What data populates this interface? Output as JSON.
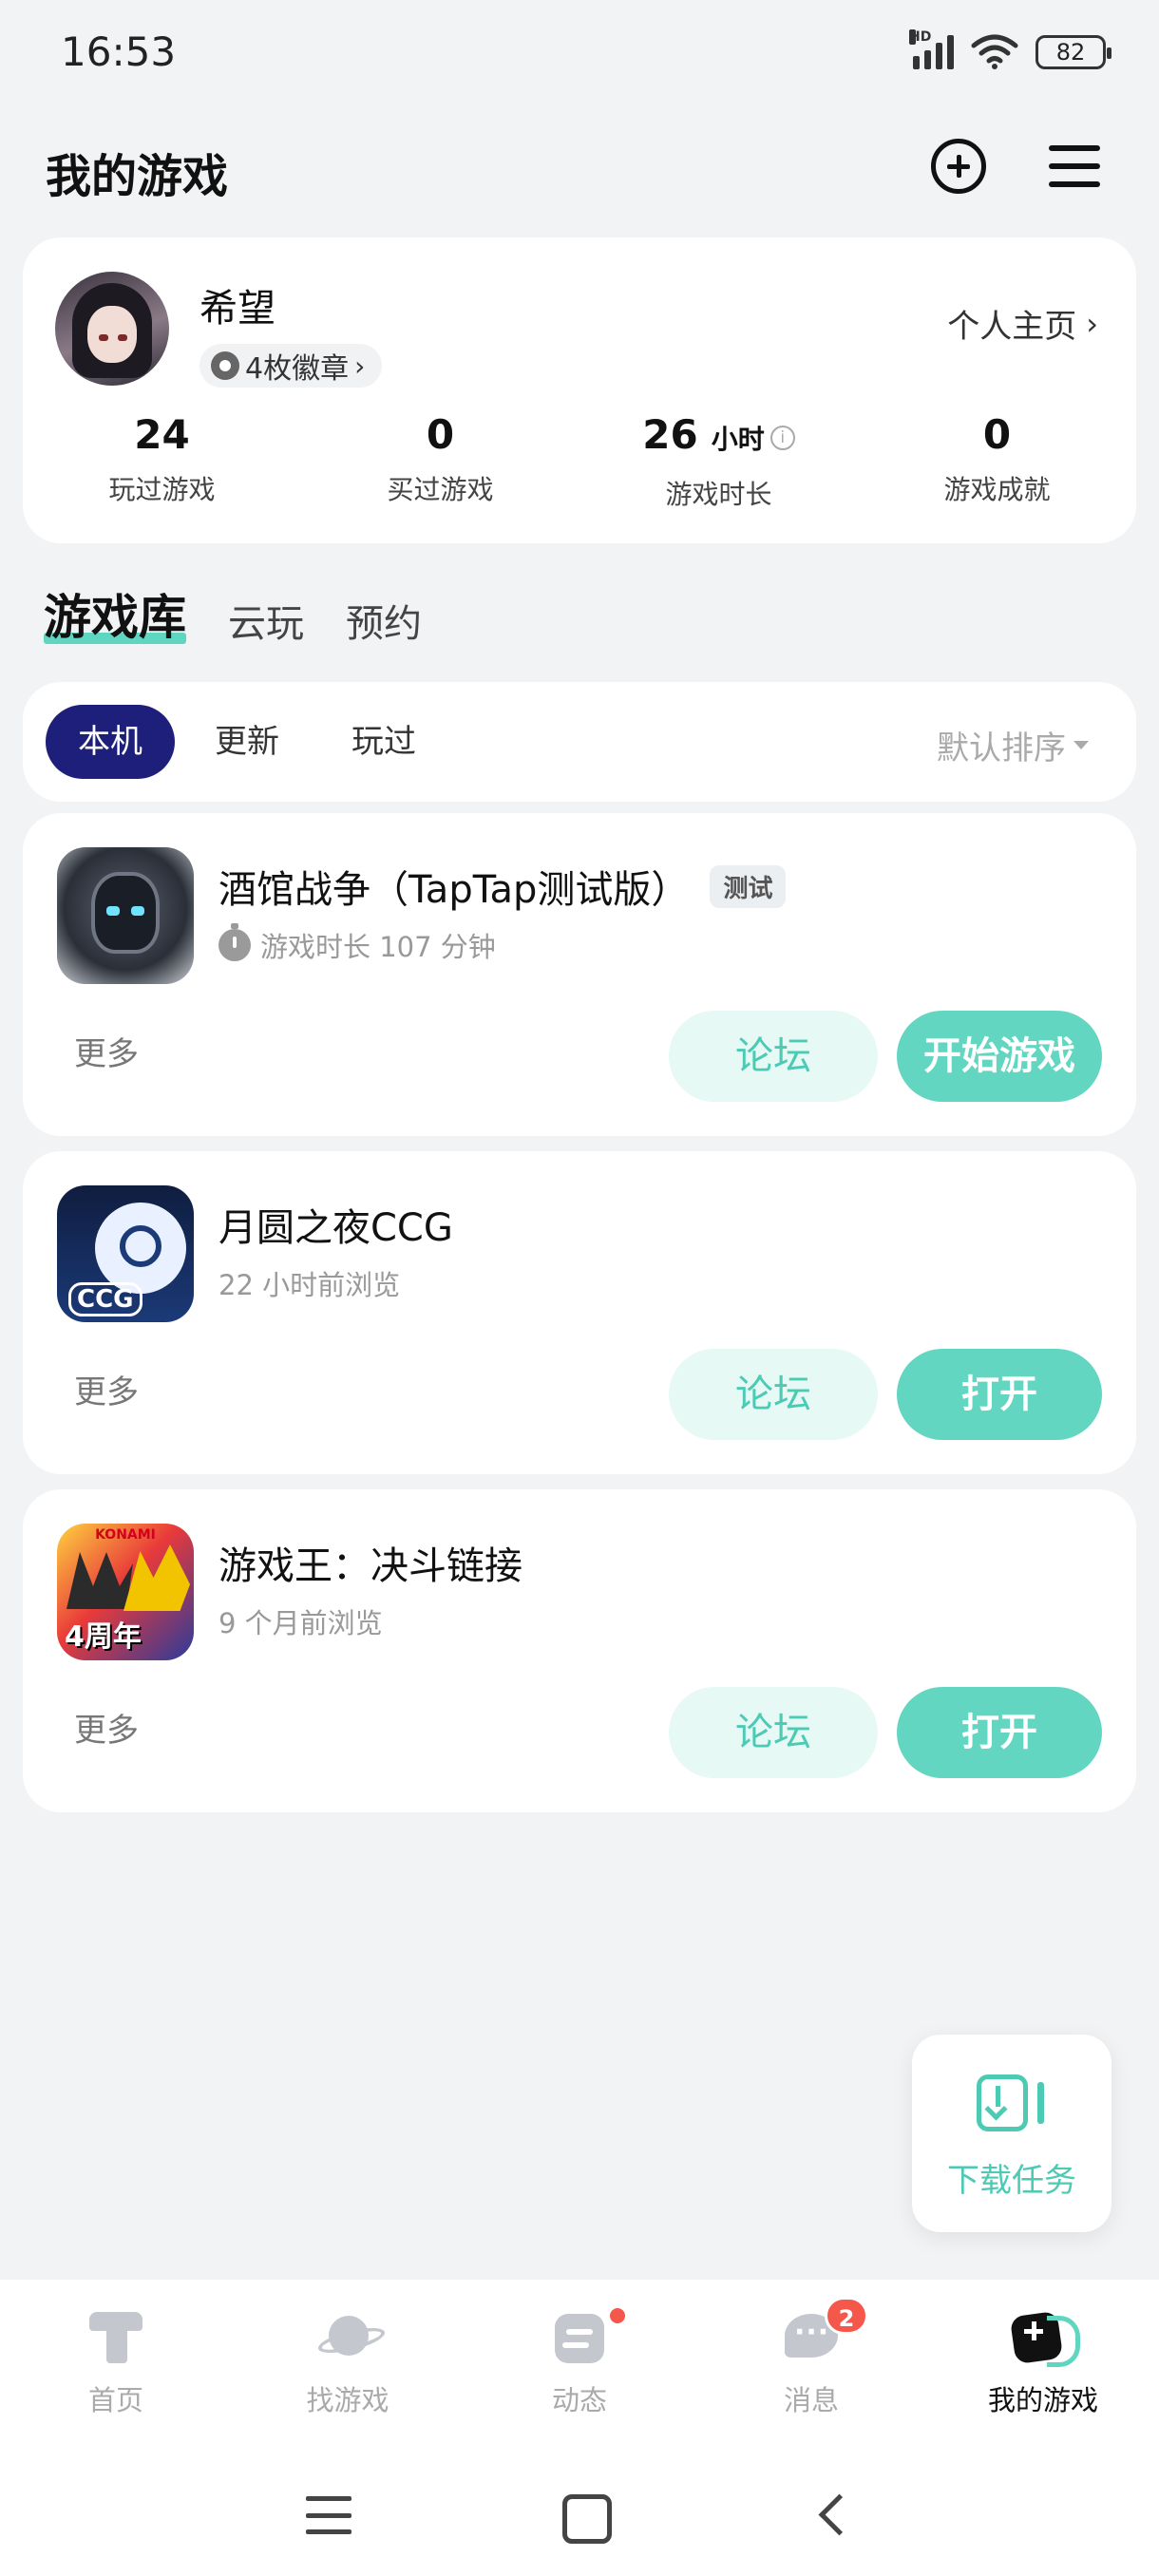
{
  "status_bar": {
    "time": "16:53",
    "network": "HD",
    "battery": "82"
  },
  "header": {
    "title": "我的游戏",
    "add_icon": "plus-circle-icon",
    "menu_icon": "hamburger-icon"
  },
  "profile": {
    "name": "希望",
    "badges": "4枚徽章",
    "home_link": "个人主页",
    "stats": [
      {
        "value": "24",
        "unit": "",
        "label": "玩过游戏"
      },
      {
        "value": "0",
        "unit": "",
        "label": "买过游戏"
      },
      {
        "value": "26",
        "unit": "小时",
        "label": "游戏时长"
      },
      {
        "value": "0",
        "unit": "",
        "label": "游戏成就"
      }
    ]
  },
  "tabs": [
    "游戏库",
    "云玩",
    "预约"
  ],
  "filters": {
    "chips": [
      "本机",
      "更新",
      "玩过"
    ],
    "sort": "默认排序"
  },
  "games": [
    {
      "name": "酒馆战争（TapTap测试版）",
      "tag": "测试",
      "sub": "游戏时长 107 分钟",
      "more": "更多",
      "forum": "论坛",
      "action": "开始游戏"
    },
    {
      "name": "月圆之夜CCG",
      "icon_text": "CCG",
      "sub": "22 小时前浏览",
      "more": "更多",
      "forum": "论坛",
      "action": "打开"
    },
    {
      "name": "游戏王：决斗链接",
      "icon_text": "KONAMI",
      "icon_text2": "4周年",
      "sub": "9 个月前浏览",
      "more": "更多",
      "forum": "论坛",
      "action": "打开"
    }
  ],
  "download": {
    "label": "下载任务"
  },
  "bottom_nav": [
    {
      "label": "首页",
      "icon": "taptap-home-icon"
    },
    {
      "label": "找游戏",
      "icon": "planet-icon"
    },
    {
      "label": "动态",
      "icon": "feed-icon"
    },
    {
      "label": "消息",
      "icon": "message-icon",
      "badge": "2"
    },
    {
      "label": "我的游戏",
      "icon": "my-games-icon"
    }
  ],
  "colors": {
    "accent": "#62d6c1",
    "active_chip": "#1e1f7a",
    "badge_red": "#f5574b"
  }
}
